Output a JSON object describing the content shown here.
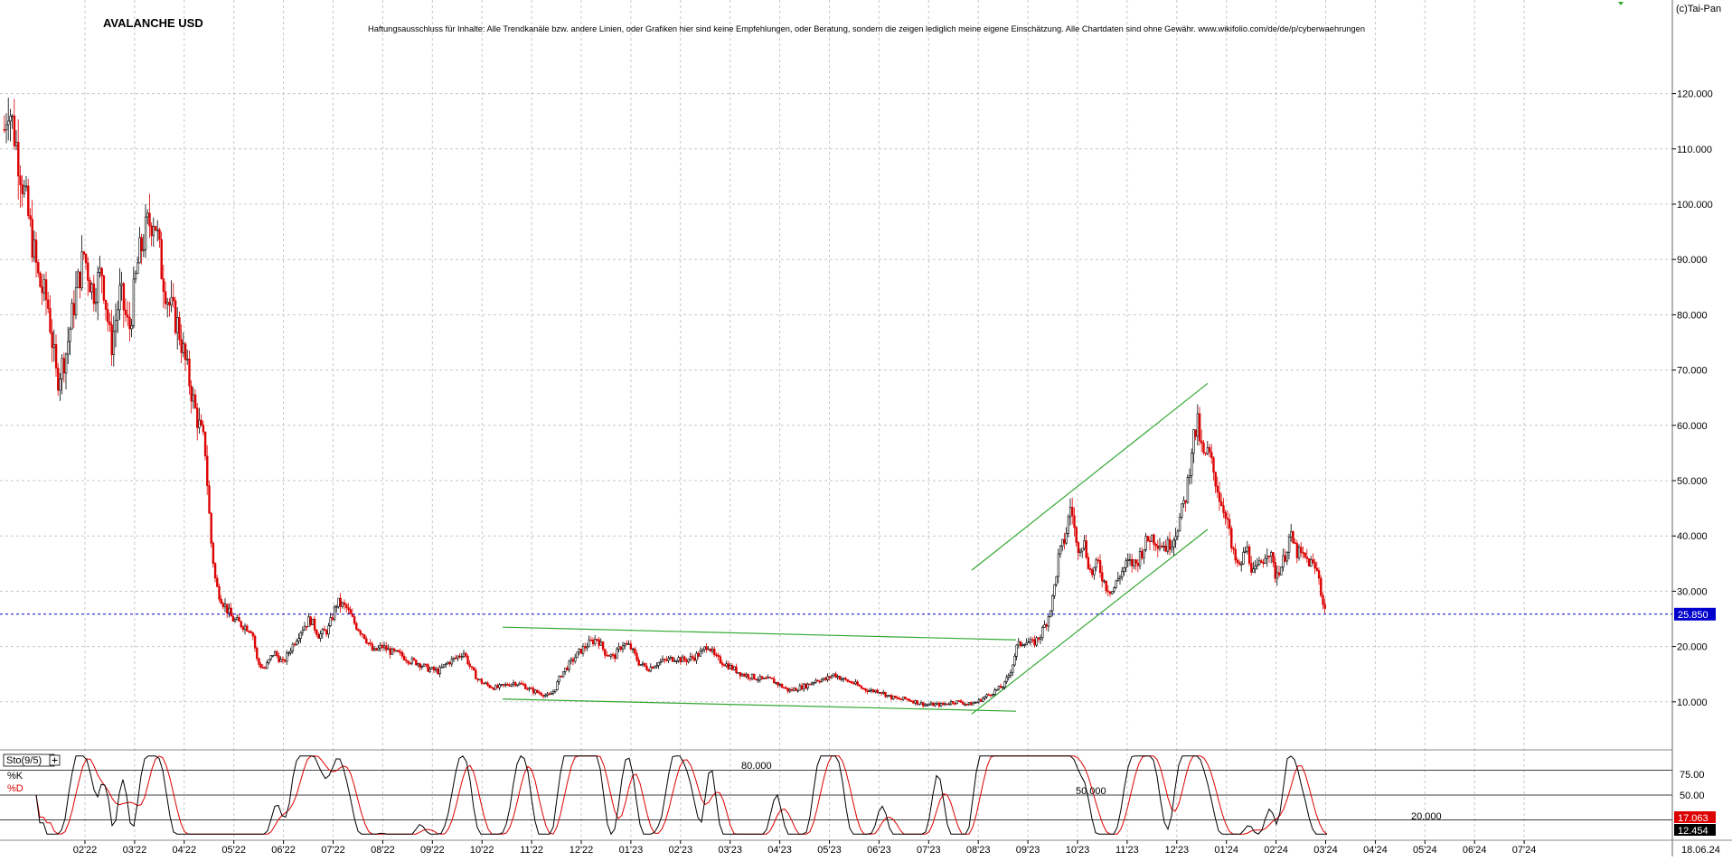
{
  "header": {
    "title": "AVALANCHE USD",
    "disclaimer": "Haftungsausschluss für Inhalte: Alle Trendkanäle bzw. andere Linien, oder Grafiken hier sind keine Empfehlungen, oder Beratung, sondern die zeigen lediglich meine eigene Einschätzung. Alle Chartdaten sind ohne Gewähr.  www.wikifolio.com/de/de/p/cyberwaehrungen",
    "copyright": "(c)Tai-Pan"
  },
  "colors": {
    "up": "#000000",
    "down": "#dd0000",
    "grid": "#c8c8c8",
    "trend": "#33a833",
    "price_line": "#0000cc",
    "price_badge": "#0000cc",
    "k_line": "#000000",
    "d_line": "#dd0000",
    "d_badge": "#dd0000",
    "k_badge": "#000000"
  },
  "chart_data": [
    {
      "type": "candlestick",
      "title": "AVALANCHE USD",
      "x_tick_labels": [
        "02'22",
        "03'22",
        "04'22",
        "05'22",
        "06'22",
        "07'22",
        "08'22",
        "09'22",
        "10'22",
        "11'22",
        "12'22",
        "01'23",
        "02'23",
        "03'23",
        "04'23",
        "05'23",
        "06'23",
        "07'23",
        "08'23",
        "09'23",
        "10'23",
        "11'23",
        "12'23",
        "01'24",
        "02'24",
        "03'24",
        "04'24",
        "05'24",
        "06'24",
        "07'24"
      ],
      "x_last_label": "18.06.24",
      "ylim": [
        0,
        125
      ],
      "y_ticks": [
        "10.000",
        "20.000",
        "30.000",
        "40.000",
        "50.000",
        "60.000",
        "70.000",
        "80.000",
        "90.000",
        "100.000",
        "110.000",
        "120.000"
      ],
      "y_tick_values": [
        10,
        20,
        30,
        40,
        50,
        60,
        70,
        80,
        90,
        100,
        110,
        120
      ],
      "grid": true,
      "last_price": 25.85,
      "last_price_label": "25.850",
      "close_anchors": [
        [
          0,
          108
        ],
        [
          8,
          119
        ],
        [
          18,
          110
        ],
        [
          30,
          98
        ],
        [
          42,
          86
        ],
        [
          52,
          82
        ],
        [
          62,
          68
        ],
        [
          72,
          73
        ],
        [
          82,
          83
        ],
        [
          92,
          91
        ],
        [
          102,
          84
        ],
        [
          112,
          88
        ],
        [
          122,
          74
        ],
        [
          132,
          84
        ],
        [
          142,
          77
        ],
        [
          152,
          90
        ],
        [
          162,
          96
        ],
        [
          170,
          98
        ],
        [
          178,
          88
        ],
        [
          186,
          82
        ],
        [
          196,
          78
        ],
        [
          206,
          70
        ],
        [
          216,
          62
        ],
        [
          226,
          56
        ],
        [
          232,
          40
        ],
        [
          238,
          31
        ],
        [
          246,
          28
        ],
        [
          256,
          25
        ],
        [
          266,
          24
        ],
        [
          278,
          23
        ],
        [
          284,
          17
        ],
        [
          292,
          16
        ],
        [
          302,
          19
        ],
        [
          312,
          17
        ],
        [
          322,
          20
        ],
        [
          332,
          23
        ],
        [
          342,
          25
        ],
        [
          352,
          22
        ],
        [
          362,
          23
        ],
        [
          372,
          28
        ],
        [
          382,
          27
        ],
        [
          392,
          24
        ],
        [
          402,
          22
        ],
        [
          412,
          19
        ],
        [
          422,
          20
        ],
        [
          432,
          19
        ],
        [
          442,
          18.5
        ],
        [
          452,
          17.5
        ],
        [
          462,
          17
        ],
        [
          472,
          16
        ],
        [
          484,
          15.5
        ],
        [
          494,
          17
        ],
        [
          504,
          18
        ],
        [
          512,
          19
        ],
        [
          520,
          16
        ],
        [
          528,
          14
        ],
        [
          538,
          13
        ],
        [
          548,
          12.5
        ],
        [
          558,
          13
        ],
        [
          568,
          13.5
        ],
        [
          578,
          13
        ],
        [
          588,
          12
        ],
        [
          598,
          11.5
        ],
        [
          606,
          11
        ],
        [
          612,
          12
        ],
        [
          620,
          15
        ],
        [
          630,
          17
        ],
        [
          640,
          19
        ],
        [
          650,
          20.5
        ],
        [
          660,
          21.5
        ],
        [
          668,
          19
        ],
        [
          678,
          18
        ],
        [
          688,
          20.5
        ],
        [
          696,
          20
        ],
        [
          706,
          17
        ],
        [
          716,
          16
        ],
        [
          726,
          17
        ],
        [
          736,
          17.5
        ],
        [
          746,
          18
        ],
        [
          756,
          17.5
        ],
        [
          766,
          18
        ],
        [
          776,
          19
        ],
        [
          782,
          20.5
        ],
        [
          790,
          18
        ],
        [
          800,
          17
        ],
        [
          810,
          16
        ],
        [
          820,
          15
        ],
        [
          832,
          14.5
        ],
        [
          842,
          14
        ],
        [
          852,
          14
        ],
        [
          862,
          13
        ],
        [
          872,
          12
        ],
        [
          882,
          12.5
        ],
        [
          892,
          13
        ],
        [
          902,
          14
        ],
        [
          912,
          14
        ],
        [
          922,
          15
        ],
        [
          932,
          14
        ],
        [
          942,
          13.5
        ],
        [
          952,
          12.5
        ],
        [
          962,
          12
        ],
        [
          972,
          12
        ],
        [
          982,
          11
        ],
        [
          992,
          10.5
        ],
        [
          1002,
          10.5
        ],
        [
          1012,
          10
        ],
        [
          1022,
          9.5
        ],
        [
          1032,
          9.5
        ],
        [
          1042,
          9.5
        ],
        [
          1052,
          10
        ],
        [
          1062,
          10
        ],
        [
          1070,
          9.5
        ],
        [
          1080,
          10
        ],
        [
          1090,
          11
        ],
        [
          1100,
          12
        ],
        [
          1110,
          13
        ],
        [
          1118,
          16
        ],
        [
          1124,
          20
        ],
        [
          1132,
          21
        ],
        [
          1142,
          20.5
        ],
        [
          1150,
          22
        ],
        [
          1158,
          25
        ],
        [
          1164,
          29
        ],
        [
          1170,
          36
        ],
        [
          1178,
          40
        ],
        [
          1184,
          46
        ],
        [
          1190,
          38
        ],
        [
          1198,
          39
        ],
        [
          1206,
          33
        ],
        [
          1214,
          35
        ],
        [
          1222,
          31
        ],
        [
          1230,
          30
        ],
        [
          1238,
          33
        ],
        [
          1246,
          35
        ],
        [
          1256,
          35
        ],
        [
          1264,
          38
        ],
        [
          1272,
          40
        ],
        [
          1280,
          39
        ],
        [
          1290,
          38
        ],
        [
          1298,
          40
        ],
        [
          1306,
          44
        ],
        [
          1312,
          48
        ],
        [
          1318,
          57
        ],
        [
          1324,
          60
        ],
        [
          1330,
          54
        ],
        [
          1336,
          55
        ],
        [
          1344,
          50
        ],
        [
          1350,
          46
        ],
        [
          1356,
          44
        ],
        [
          1362,
          37
        ],
        [
          1370,
          34
        ],
        [
          1378,
          38
        ],
        [
          1386,
          33
        ],
        [
          1394,
          35
        ],
        [
          1402,
          38
        ],
        [
          1410,
          33
        ],
        [
          1418,
          35
        ],
        [
          1426,
          40
        ],
        [
          1434,
          37
        ],
        [
          1442,
          36
        ],
        [
          1450,
          35
        ],
        [
          1458,
          33
        ],
        [
          1462,
          28
        ],
        [
          1466,
          26
        ]
      ],
      "trendlines": [
        {
          "from": [
            556,
            23.5
          ],
          "to": [
            1124,
            21.2
          ]
        },
        {
          "from": [
            556,
            10.5
          ],
          "to": [
            1124,
            8.3
          ]
        },
        {
          "from": [
            1075,
            33.8
          ],
          "to": [
            1336,
            67.6
          ]
        },
        {
          "from": [
            1075,
            7.8
          ],
          "to": [
            1336,
            41.2
          ]
        }
      ]
    },
    {
      "type": "line",
      "title": "Sto(9/5)",
      "series": [
        {
          "name": "%K",
          "values": [
            0,
            0
          ]
        },
        {
          "name": "%D",
          "values": [
            0,
            0
          ]
        }
      ],
      "levels": [
        {
          "value": 80,
          "label": "80.000"
        },
        {
          "value": 50,
          "label": "50.000"
        },
        {
          "value": 20,
          "label": "20.000"
        }
      ],
      "y_ticks": [
        "75.00",
        "50.00"
      ],
      "y_tick_values": [
        75,
        50
      ],
      "d_last_label": "17.063",
      "k_last_label": "12.454"
    }
  ]
}
